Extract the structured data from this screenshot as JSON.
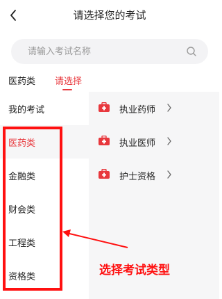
{
  "header": {
    "title": "请选择您的考试"
  },
  "search": {
    "placeholder": "请输入考试名称"
  },
  "breadcrumb": [
    "医药类",
    "请选择"
  ],
  "left_menu": [
    "我的考试",
    "医药类",
    "金融类",
    "财会类",
    "工程类",
    "资格类"
  ],
  "active_category": "医药类",
  "exams": [
    "执业药师",
    "执业医师",
    "护士资格"
  ],
  "annotation": {
    "text": "选择考试类型"
  },
  "colors": {
    "accent": "#e8383d",
    "annotation": "#ff1010",
    "panel": "#f6f6f7"
  },
  "icons": {
    "back": "chevron-left-icon",
    "search": "search-icon",
    "exam": "medical-kit-icon",
    "row": "chevron-right-icon"
  }
}
